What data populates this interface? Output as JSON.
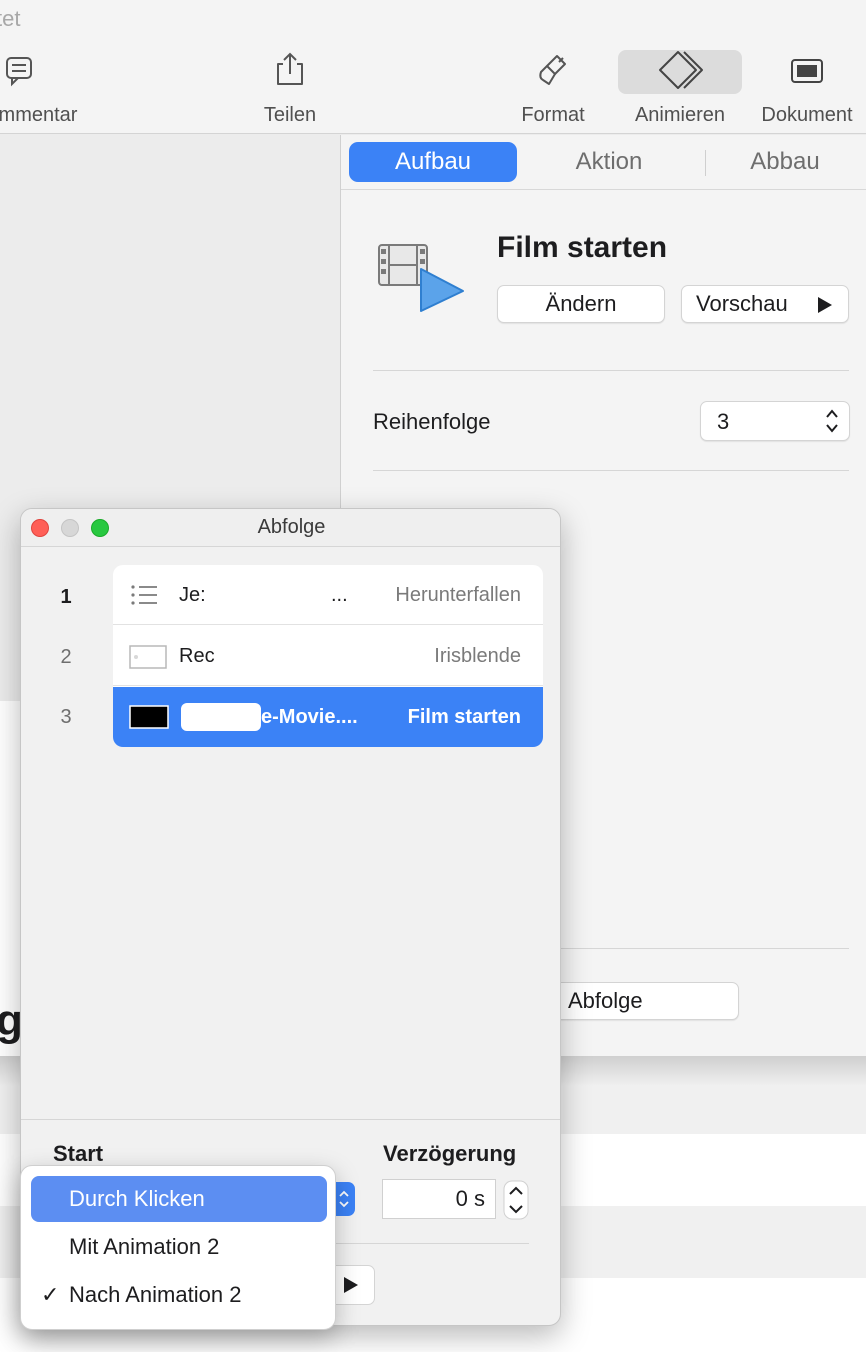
{
  "toolbar": {
    "window_title_fragment": "tet",
    "items": [
      {
        "label": "mmentar",
        "icon": "comment-icon"
      },
      {
        "label": "Teilen",
        "icon": "share-icon"
      },
      {
        "label": "Format",
        "icon": "paintbrush-icon"
      },
      {
        "label": "Animieren",
        "icon": "animate-diamond-icon",
        "active": true
      },
      {
        "label": "Dokument",
        "icon": "document-icon"
      }
    ]
  },
  "stage": {
    "text_fragment": "g"
  },
  "inspector": {
    "tabs": [
      {
        "label": "Aufbau",
        "active": true
      },
      {
        "label": "Aktion",
        "active": false
      },
      {
        "label": "Abbau",
        "active": false
      }
    ],
    "effect": {
      "icon": "film-play-icon",
      "title": "Film starten",
      "change_label": "Ändern",
      "preview_label": "Vorschau",
      "preview_icon": "play-icon"
    },
    "order": {
      "label": "Reihenfolge",
      "value": "3"
    },
    "sequence_button_label": "Abfolge"
  },
  "sequence_window": {
    "title": "Abfolge",
    "rows": [
      {
        "number": "1",
        "name": "Je:",
        "name_tail": "...",
        "effect": "Herunterfallen",
        "thumb": "list-icon",
        "selected": false,
        "current": true
      },
      {
        "number": "2",
        "name": "Rec",
        "effect": "Irisblende",
        "thumb": "image-thumbnail-icon",
        "selected": false
      },
      {
        "number": "3",
        "name": "e-Movie....",
        "effect": "Film starten",
        "thumb": "movie-thumbnail-icon",
        "selected": true
      }
    ],
    "start_label": "Start",
    "delay_label": "Verzögerung",
    "delay_value": "0 s"
  },
  "start_menu": {
    "items": [
      {
        "label": "Durch Klicken",
        "highlighted": true,
        "checked": false
      },
      {
        "label": "Mit Animation 2",
        "highlighted": false,
        "checked": false
      },
      {
        "label": "Nach Animation 2",
        "highlighted": false,
        "checked": true
      }
    ],
    "check_glyph": "✓"
  },
  "colors": {
    "accent": "#3b82f6",
    "menu_highlight": "#5c8ef2",
    "close": "#ff5f57",
    "maximize": "#28c840"
  }
}
